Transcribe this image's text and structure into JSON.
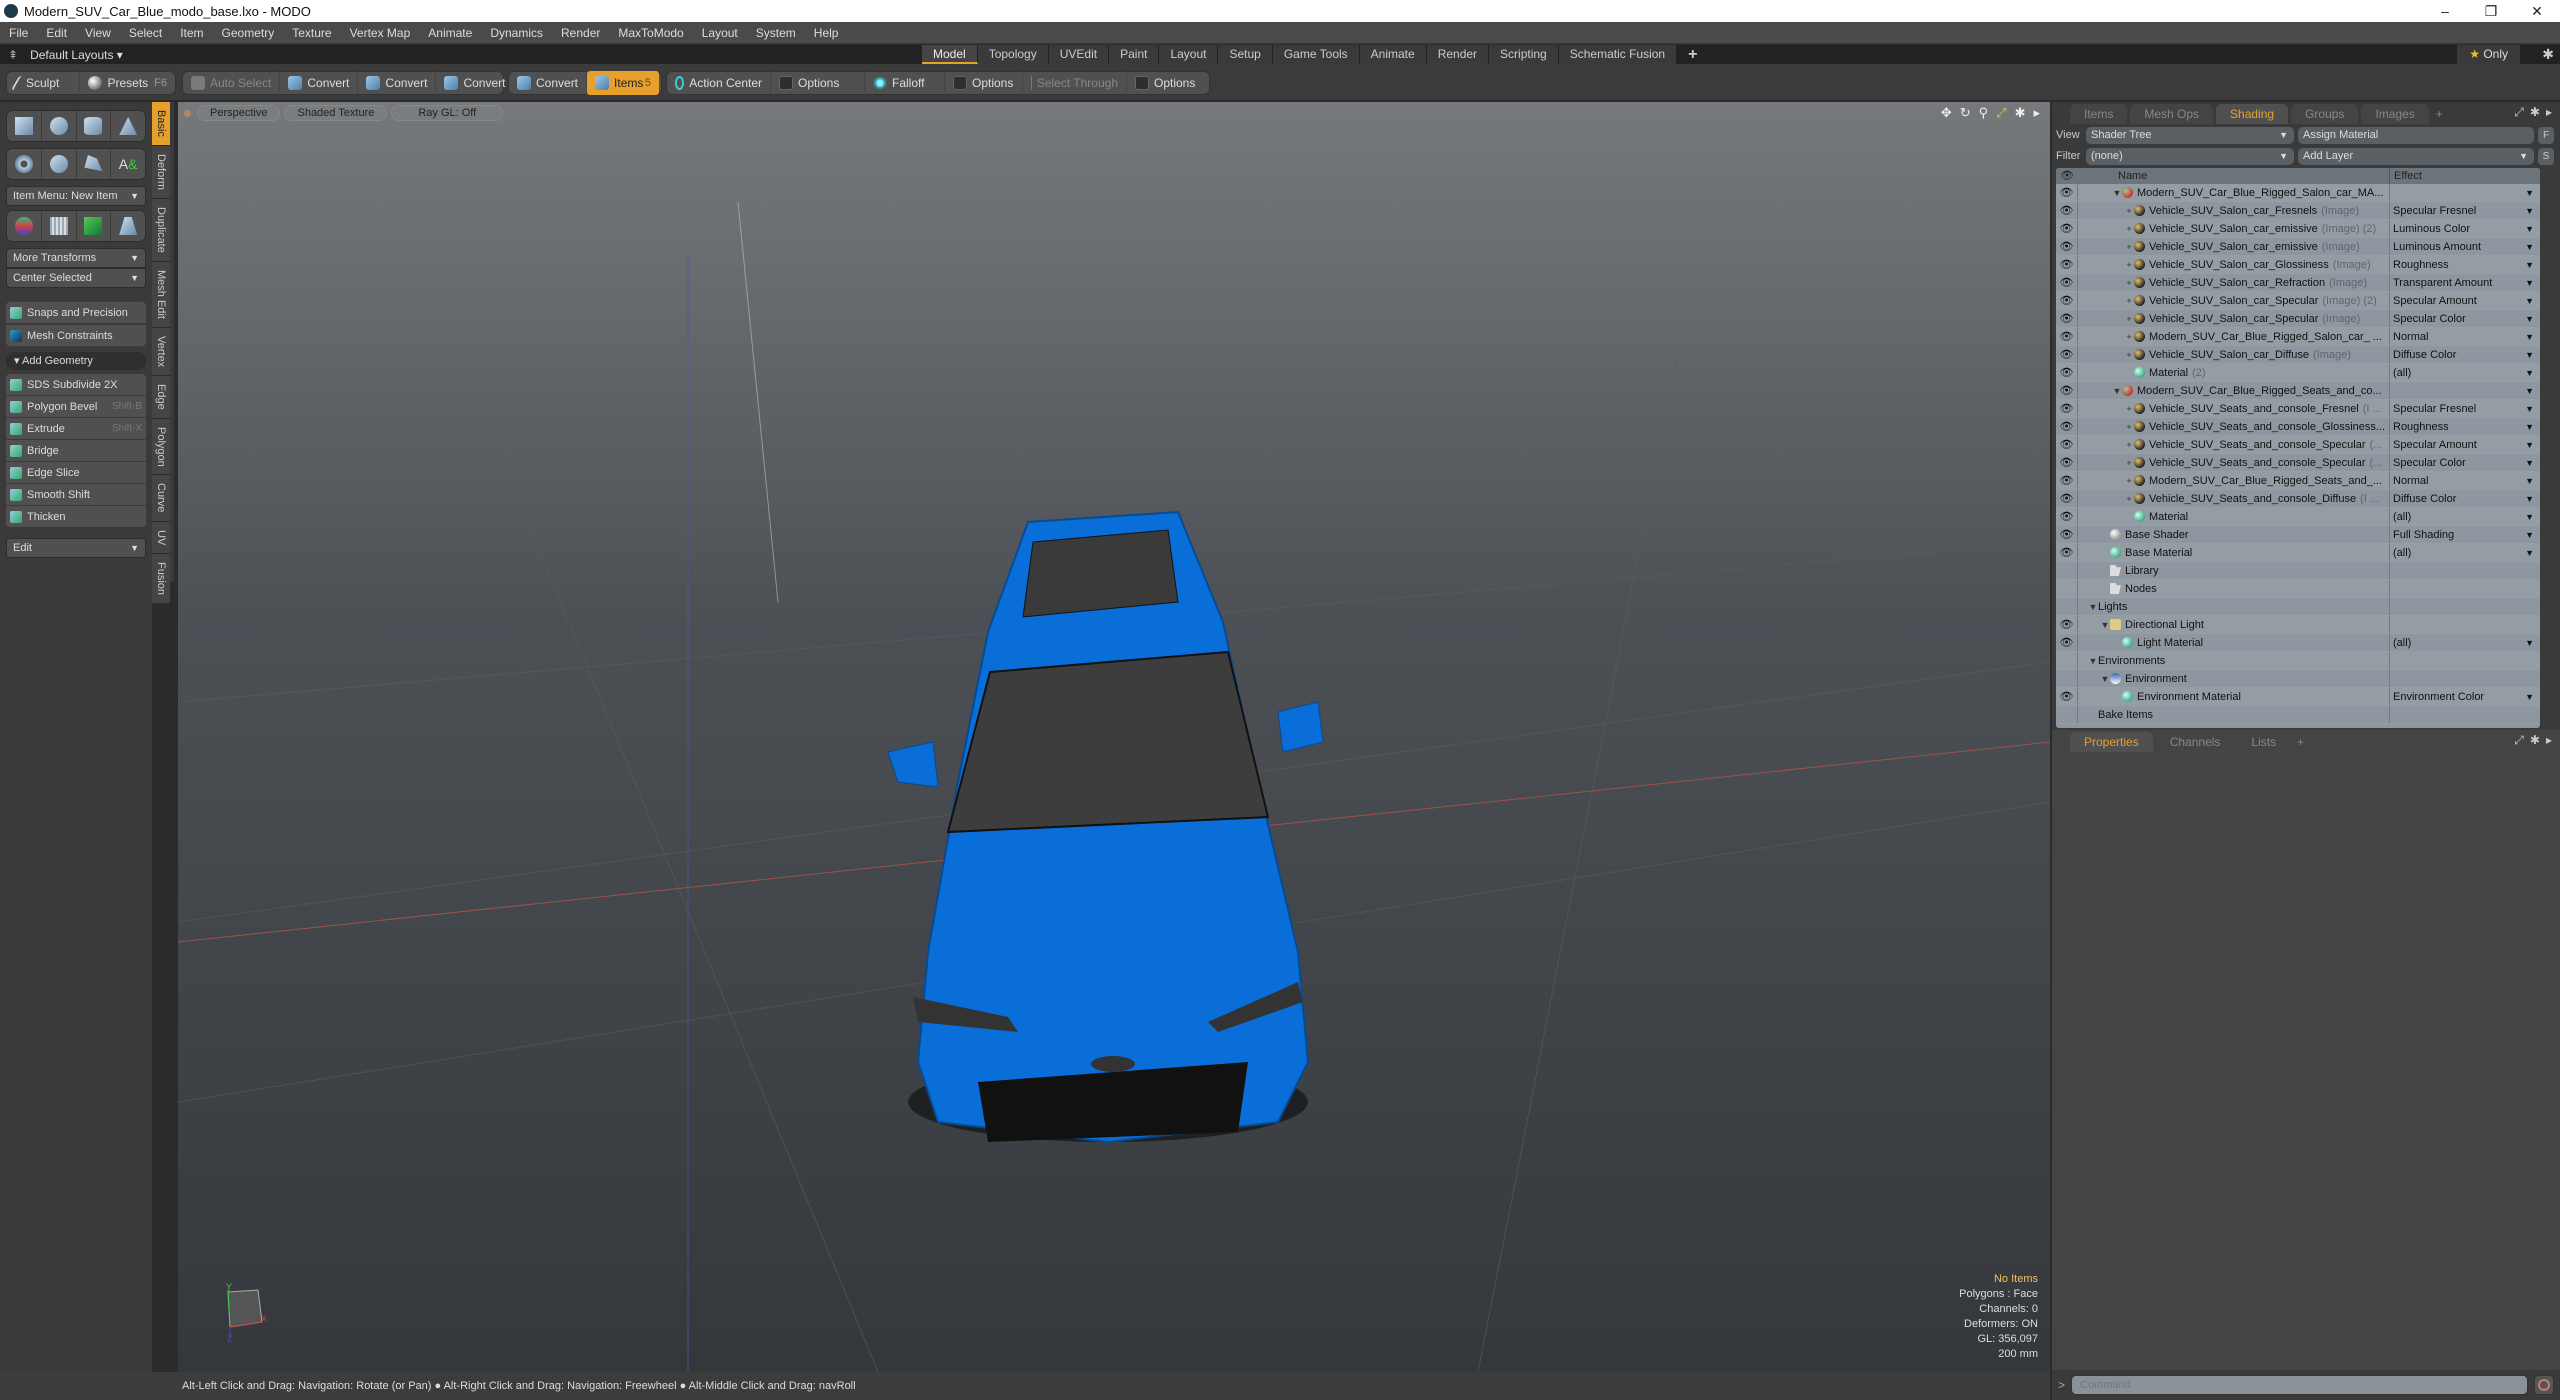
{
  "window": {
    "title": "Modern_SUV_Car_Blue_modo_base.lxo - MODO",
    "controls": [
      "–",
      "❐",
      "✕"
    ]
  },
  "menu": [
    "File",
    "Edit",
    "View",
    "Select",
    "Item",
    "Geometry",
    "Texture",
    "Vertex Map",
    "Animate",
    "Dynamics",
    "Render",
    "MaxToModo",
    "Layout",
    "System",
    "Help"
  ],
  "layout_selector": "Default Layouts ▾",
  "layout_tabs": [
    "Model",
    "Topology",
    "UVEdit",
    "Paint",
    "Layout",
    "Setup",
    "Game Tools",
    "Animate",
    "Render",
    "Scripting",
    "Schematic Fusion"
  ],
  "active_layout_tab": "Model",
  "only_label": "Only",
  "toolbar": {
    "sculpt": "Sculpt",
    "presets": "Presets",
    "presets_key": "F6",
    "auto_select": "Auto Select",
    "convert1": "Convert",
    "convert2": "Convert",
    "convert3": "Convert",
    "convert4": "Convert",
    "items": "Items",
    "items_count": "5",
    "action_center": "Action Center",
    "options1": "Options",
    "falloff": "Falloff",
    "options2": "Options",
    "select_through": "Select Through",
    "options3": "Options"
  },
  "left_panel": {
    "item_menu": "Item Menu: New Item",
    "more_transforms": "More Transforms",
    "center_selected": "Center Selected",
    "snaps": "Snaps and Precision",
    "mesh_constraints": "Mesh Constraints",
    "add_geometry": "Add Geometry",
    "tools": [
      {
        "label": "SDS Subdivide 2X",
        "shortcut": ""
      },
      {
        "label": "Polygon Bevel",
        "shortcut": "Shift-B"
      },
      {
        "label": "Extrude",
        "shortcut": "Shift-X"
      },
      {
        "label": "Bridge",
        "shortcut": ""
      },
      {
        "label": "Edge Slice",
        "shortcut": ""
      },
      {
        "label": "Smooth Shift",
        "shortcut": ""
      },
      {
        "label": "Thicken",
        "shortcut": ""
      }
    ],
    "edit": "Edit",
    "vertical_tabs": [
      "Basic",
      "Deform",
      "Duplicate",
      "Mesh Edit",
      "Vertex",
      "Edge",
      "Polygon",
      "Curve",
      "UV",
      "Fusion"
    ]
  },
  "viewport": {
    "view": "Perspective",
    "shading": "Shaded Texture",
    "raygl": "Ray GL: Off",
    "info": {
      "items": "No Items",
      "polygons": "Polygons : Face",
      "channels": "Channels: 0",
      "deformers": "Deformers: ON",
      "gl": "GL: 356,097",
      "scale": "200 mm"
    },
    "axis": {
      "x": "X",
      "y": "Y",
      "z": "Z"
    }
  },
  "status_bar": "Alt-Left Click and Drag: Navigation: Rotate (or Pan) ● Alt-Right Click and Drag: Navigation: Freewheel ● Alt-Middle Click and Drag: navRoll",
  "right_panel": {
    "tabs": [
      "Items",
      "Mesh Ops",
      "Shading",
      "Groups",
      "Images"
    ],
    "active_tab": "Shading",
    "view_label": "View",
    "view_value": "Shader Tree",
    "assign_material": "Assign Material",
    "filter_label": "Filter",
    "filter_value": "(none)",
    "add_layer": "Add Layer",
    "f_btn": "F",
    "s_btn": "S",
    "columns": {
      "name": "Name",
      "effect": "Effect"
    },
    "rows": [
      {
        "eye": true,
        "indent": 2,
        "exp": "▼",
        "icon": "grp",
        "name": "Modern_SUV_Car_Blue_Rigged_Salon_car_MA...",
        "dim": "",
        "effect": "",
        "drop": true
      },
      {
        "eye": true,
        "indent": 3,
        "exp": "+",
        "icon": "img",
        "name": "Vehicle_SUV_Salon_car_Fresnels",
        "dim": "(Image)",
        "effect": "Specular Fresnel",
        "drop": true
      },
      {
        "eye": true,
        "indent": 3,
        "exp": "+",
        "icon": "img",
        "name": "Vehicle_SUV_Salon_car_emissive",
        "dim": "(Image) (2)",
        "effect": "Luminous Color",
        "drop": true
      },
      {
        "eye": true,
        "indent": 3,
        "exp": "+",
        "icon": "img",
        "name": "Vehicle_SUV_Salon_car_emissive",
        "dim": "(Image)",
        "effect": "Luminous Amount",
        "drop": true
      },
      {
        "eye": true,
        "indent": 3,
        "exp": "+",
        "icon": "img",
        "name": "Vehicle_SUV_Salon_car_Glossiness",
        "dim": "(Image)",
        "effect": "Roughness",
        "drop": true
      },
      {
        "eye": true,
        "indent": 3,
        "exp": "+",
        "icon": "img",
        "name": "Vehicle_SUV_Salon_car_Refraction",
        "dim": "(Image)",
        "effect": "Transparent Amount",
        "drop": true
      },
      {
        "eye": true,
        "indent": 3,
        "exp": "+",
        "icon": "img",
        "name": "Vehicle_SUV_Salon_car_Specular",
        "dim": "(Image) (2)",
        "effect": "Specular Amount",
        "drop": true
      },
      {
        "eye": true,
        "indent": 3,
        "exp": "+",
        "icon": "img",
        "name": "Vehicle_SUV_Salon_car_Specular",
        "dim": "(Image)",
        "effect": "Specular Color",
        "drop": true
      },
      {
        "eye": true,
        "indent": 3,
        "exp": "+",
        "icon": "img",
        "name": "Modern_SUV_Car_Blue_Rigged_Salon_car_ ...",
        "dim": "",
        "effect": "Normal",
        "drop": true
      },
      {
        "eye": true,
        "indent": 3,
        "exp": "+",
        "icon": "img",
        "name": "Vehicle_SUV_Salon_car_Diffuse",
        "dim": "(Image)",
        "effect": "Diffuse Color",
        "drop": true
      },
      {
        "eye": true,
        "indent": 3,
        "exp": "",
        "icon": "mat",
        "name": "Material",
        "dim": "(2)",
        "effect": "(all)",
        "drop": true
      },
      {
        "eye": true,
        "indent": 2,
        "exp": "▼",
        "icon": "grp",
        "name": "Modern_SUV_Car_Blue_Rigged_Seats_and_co...",
        "dim": "",
        "effect": "",
        "drop": true
      },
      {
        "eye": true,
        "indent": 3,
        "exp": "+",
        "icon": "img",
        "name": "Vehicle_SUV_Seats_and_console_Fresnel",
        "dim": "(I ...",
        "effect": "Specular Fresnel",
        "drop": true
      },
      {
        "eye": true,
        "indent": 3,
        "exp": "+",
        "icon": "img",
        "name": "Vehicle_SUV_Seats_and_console_Glossiness...",
        "dim": "",
        "effect": "Roughness",
        "drop": true
      },
      {
        "eye": true,
        "indent": 3,
        "exp": "+",
        "icon": "img",
        "name": "Vehicle_SUV_Seats_and_console_Specular",
        "dim": "(...",
        "effect": "Specular Amount",
        "drop": true
      },
      {
        "eye": true,
        "indent": 3,
        "exp": "+",
        "icon": "img",
        "name": "Vehicle_SUV_Seats_and_console_Specular",
        "dim": "(...",
        "effect": "Specular Color",
        "drop": true
      },
      {
        "eye": true,
        "indent": 3,
        "exp": "+",
        "icon": "img",
        "name": "Modern_SUV_Car_Blue_Rigged_Seats_and_...",
        "dim": "",
        "effect": "Normal",
        "drop": true
      },
      {
        "eye": true,
        "indent": 3,
        "exp": "+",
        "icon": "img",
        "name": "Vehicle_SUV_Seats_and_console_Diffuse",
        "dim": "(I ...",
        "effect": "Diffuse Color",
        "drop": true
      },
      {
        "eye": true,
        "indent": 3,
        "exp": "",
        "icon": "mat",
        "name": "Material",
        "dim": "",
        "effect": "(all)",
        "drop": true
      },
      {
        "eye": true,
        "indent": 1,
        "exp": "",
        "icon": "shd",
        "name": "Base Shader",
        "dim": "",
        "effect": "Full Shading",
        "drop": true
      },
      {
        "eye": true,
        "indent": 1,
        "exp": "",
        "icon": "mat",
        "name": "Base Material",
        "dim": "",
        "effect": "(all)",
        "drop": true
      },
      {
        "eye": false,
        "indent": 1,
        "exp": "",
        "icon": "fold",
        "name": "Library",
        "dim": "",
        "effect": "",
        "drop": false
      },
      {
        "eye": false,
        "indent": 1,
        "exp": "",
        "icon": "fold",
        "name": "Nodes",
        "dim": "",
        "effect": "",
        "drop": false
      },
      {
        "eye": false,
        "indent": 0,
        "exp": "▼",
        "icon": "",
        "name": "Lights",
        "dim": "",
        "effect": "",
        "drop": false
      },
      {
        "eye": true,
        "indent": 1,
        "exp": "▼",
        "icon": "light",
        "name": "Directional Light",
        "dim": "",
        "effect": "",
        "drop": false
      },
      {
        "eye": true,
        "indent": 2,
        "exp": "",
        "icon": "mat",
        "name": "Light Material",
        "dim": "",
        "effect": "(all)",
        "drop": true
      },
      {
        "eye": false,
        "indent": 0,
        "exp": "▼",
        "icon": "",
        "name": "Environments",
        "dim": "",
        "effect": "",
        "drop": false
      },
      {
        "eye": false,
        "indent": 1,
        "exp": "▼",
        "icon": "env",
        "name": "Environment",
        "dim": "",
        "effect": "",
        "drop": false
      },
      {
        "eye": true,
        "indent": 2,
        "exp": "",
        "icon": "mat",
        "name": "Environment Material",
        "dim": "",
        "effect": "Environment Color",
        "drop": true
      },
      {
        "eye": false,
        "indent": 0,
        "exp": "",
        "icon": "",
        "name": "Bake Items",
        "dim": "",
        "effect": "",
        "drop": false
      }
    ],
    "bottom_tabs": [
      "Properties",
      "Channels",
      "Lists"
    ],
    "active_bottom_tab": "Properties"
  },
  "command": {
    "placeholder": "Command",
    "prompt": ">"
  },
  "colors": {
    "accent": "#e8a02c",
    "car_blue": "#0a6ed8"
  }
}
